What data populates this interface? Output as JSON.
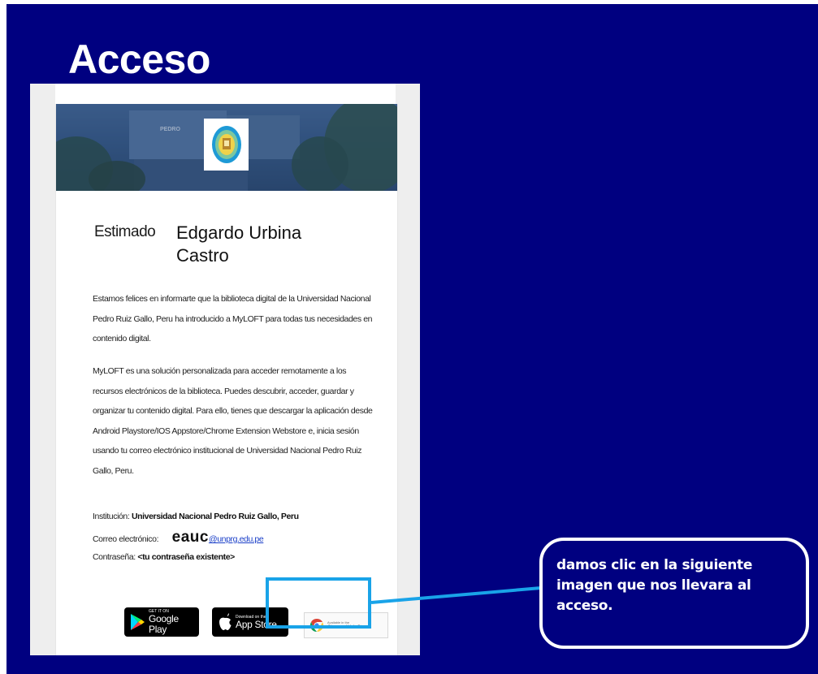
{
  "slide": {
    "title": "Acceso",
    "background_color": "#000080"
  },
  "email": {
    "banner": {
      "building_sign": "PEDRO",
      "seal_icon": "university-seal-icon"
    },
    "greeting_label": "Estimado",
    "recipient_name": "Edgardo Urbina Castro",
    "paragraph1": "Estamos felices en informarte que la biblioteca digital de la Universidad Nacional Pedro Ruiz Gallo, Peru ha introducido a MyLOFT para todas tus necesidades en contenido digital.",
    "paragraph2": "MyLOFT es una solución personalizada para acceder remotamente a los recursos electrónicos de la biblioteca. Puedes descubrir, acceder, guardar y organizar tu contenido digital. Para ello, tienes que descargar la aplicación desde Android Playstore/IOS Appstore/Chrome Extension Webstore e, inicia sesión usando tu correo electrónico institucional de Universidad Nacional Pedro Ruiz Gallo, Peru.",
    "institution_label": "Institución:",
    "institution_value": "Universidad Nacional Pedro Ruiz Gallo, Peru",
    "email_label": "Correo electrónico:",
    "email_user": "eauc",
    "email_domain": "@unprg.edu.pe",
    "password_label": "Contraseña:",
    "password_value": "<tu contraseña existente>",
    "stores": {
      "google_small": "GET IT ON",
      "google_big": "Google Play",
      "google_icon": "google-play-icon",
      "apple_small": "Download on the",
      "apple_big": "App Store",
      "apple_icon": "apple-icon",
      "chrome_small": "Available in the",
      "chrome_big": "Chrome Web Store",
      "chrome_icon": "chrome-icon"
    }
  },
  "callout": {
    "text": "damos clic en la siguiente imagen que nos llevara al acceso.",
    "border_color": "#ffffff",
    "highlight_color": "#19a3e8"
  }
}
